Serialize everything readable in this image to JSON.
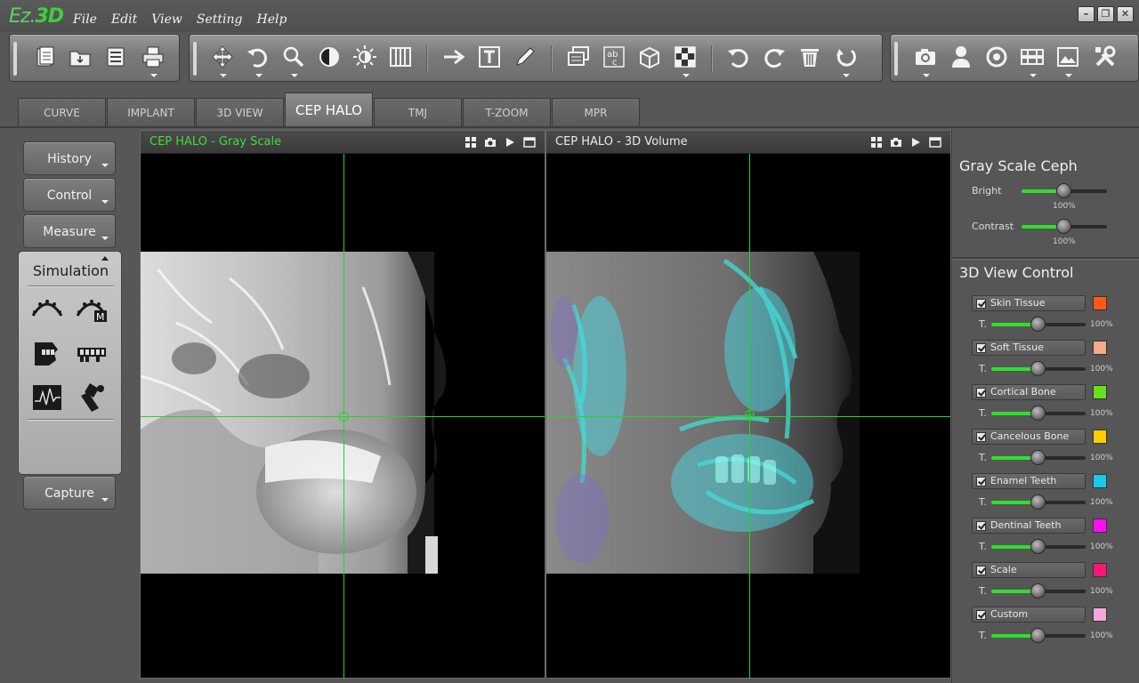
{
  "app": {
    "logo_main": "Ez.",
    "logo_accent": "3D"
  },
  "menu": [
    "File",
    "Edit",
    "View",
    "Setting",
    "Help"
  ],
  "window_controls": [
    "minimize-icon",
    "restore-icon",
    "close-icon"
  ],
  "toolbar": {
    "file_tools": [
      "new-document-icon",
      "open-folder-icon",
      "save-icon",
      "print-icon"
    ],
    "view_tools": [
      "move-icon",
      "rotate-icon",
      "zoom-icon",
      "window-level-icon",
      "brightness-icon",
      "panorama-icon",
      "arrow-icon",
      "text-icon",
      "pencil-icon",
      "layers-icon",
      "abc-icon",
      "box-icon",
      "checker-icon",
      "undo-icon",
      "redo-icon",
      "trash-icon",
      "reset-icon"
    ],
    "capture_tools": [
      "camera-icon",
      "person-icon",
      "target-icon",
      "compare-icon",
      "image-icon",
      "tools-icon"
    ]
  },
  "tabs": [
    "CURVE",
    "IMPLANT",
    "3D VIEW",
    "CEP HALO",
    "TMJ",
    "T-ZOOM",
    "MPR"
  ],
  "active_tab": "CEP HALO",
  "left_panel": {
    "history": "History",
    "control": "Control",
    "measure": "Measure",
    "simulation": "Simulation",
    "capture": "Capture",
    "sim_tools": [
      "arch-icon",
      "arch-m-icon",
      "face-teeth-icon",
      "dentition-icon",
      "waveform-icon",
      "tooth-tool-icon"
    ]
  },
  "viewports": {
    "left": {
      "title": "CEP HALO - Gray Scale"
    },
    "right": {
      "title": "CEP HALO - 3D Volume"
    }
  },
  "gray_scale": {
    "title": "Gray Scale Ceph",
    "bright_label": "Bright",
    "bright_value": "100%",
    "contrast_label": "Contrast",
    "contrast_value": "100%",
    "bright_level": 0.5,
    "contrast_level": 0.5
  },
  "view3d": {
    "title": "3D View Control",
    "t_label": "T.",
    "layers": [
      {
        "name": "Skin Tissue",
        "color": "#ff5a14",
        "value": "100%",
        "level": 0.5
      },
      {
        "name": "Soft Tissue",
        "color": "#f7a98b",
        "value": "100%",
        "level": 0.5
      },
      {
        "name": "Cortical Bone",
        "color": "#66e01e",
        "value": "100%",
        "level": 0.5
      },
      {
        "name": "Cancelous Bone",
        "color": "#ffcc00",
        "value": "100%",
        "level": 0.5
      },
      {
        "name": "Enamel Teeth",
        "color": "#1cc8f0",
        "value": "100%",
        "level": 0.5
      },
      {
        "name": "Dentinal Teeth",
        "color": "#ff10f0",
        "value": "100%",
        "level": 0.5
      },
      {
        "name": "Scale",
        "color": "#ff1478",
        "value": "100%",
        "level": 0.5
      },
      {
        "name": "Custom",
        "color": "#f5a8d8",
        "value": "100%",
        "level": 0.5
      }
    ]
  }
}
